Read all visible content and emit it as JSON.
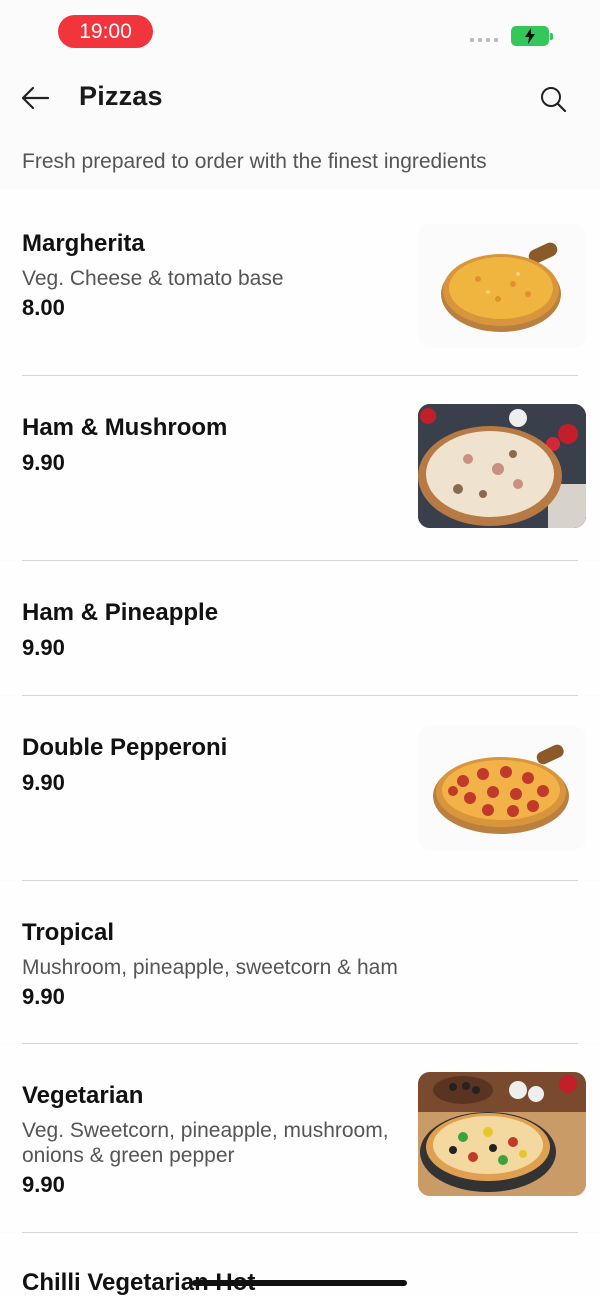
{
  "status": {
    "time": "19:00",
    "battery_color": "#34c759",
    "time_pill_color": "#f2343d"
  },
  "header": {
    "title": "Pizzas",
    "back_icon": "arrow-left-icon",
    "search_icon": "search-icon"
  },
  "subtitle": "Fresh prepared to order with the finest ingredients",
  "items": [
    {
      "name": "Margherita",
      "description": "Veg. Cheese & tomato base",
      "price": "8.00",
      "image": "cheese-pizza-on-board"
    },
    {
      "name": "Ham & Mushroom",
      "description": "",
      "price": "9.90",
      "image": "ham-mushroom-pizza-photo"
    },
    {
      "name": "Ham & Pineapple",
      "description": "",
      "price": "9.90",
      "image": ""
    },
    {
      "name": "Double Pepperoni",
      "description": "",
      "price": "9.90",
      "image": "pepperoni-pizza-on-board"
    },
    {
      "name": "Tropical",
      "description": "Mushroom, pineapple, sweetcorn & ham",
      "price": "9.90",
      "image": ""
    },
    {
      "name": "Vegetarian",
      "description_line1": "Veg. Sweetcorn, pineapple, mushroom,",
      "description_line2": "onions & green pepper",
      "price": "9.90",
      "image": "vegetarian-pizza-photo"
    },
    {
      "name": "Chilli Vegetarian Hot"
    }
  ]
}
